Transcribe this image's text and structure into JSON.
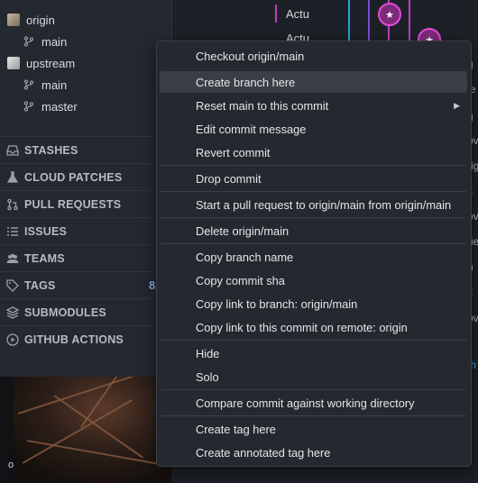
{
  "sidebar": {
    "remotes": [
      {
        "name": "origin",
        "branches": [
          "main"
        ]
      },
      {
        "name": "upstream",
        "branches": [
          "main",
          "master"
        ]
      }
    ],
    "sections": [
      {
        "label": "STASHES",
        "icon": "inbox-icon",
        "count": ""
      },
      {
        "label": "CLOUD PATCHES",
        "icon": "flask-icon",
        "count": ""
      },
      {
        "label": "PULL REQUESTS",
        "icon": "pull-request-icon",
        "count": ""
      },
      {
        "label": "ISSUES",
        "icon": "list-icon",
        "count": ""
      },
      {
        "label": "TEAMS",
        "icon": "people-icon",
        "count": ""
      },
      {
        "label": "TAGS",
        "icon": "tag-icon",
        "count": "8/"
      },
      {
        "label": "SUBMODULES",
        "icon": "stack-icon",
        "count": ""
      },
      {
        "label": "GITHUB ACTIONS",
        "icon": "play-icon",
        "count": ""
      }
    ],
    "bottom_letter": "o"
  },
  "graph": {
    "row_labels": [
      "Actu",
      "Actu"
    ],
    "edge_chars": [
      "g",
      "ie",
      "g",
      "ov",
      "rig",
      "k",
      "ov",
      "ue",
      "h",
      "k",
      "ov",
      "th"
    ]
  },
  "context_menu": {
    "highlighted": "Create branch here",
    "groups": [
      [
        "Checkout origin/main",
        "Create branch here",
        "Reset main to this commit",
        "Edit commit message",
        "Revert commit"
      ],
      [
        "Drop commit"
      ],
      [
        "Start a pull request to origin/main from origin/main"
      ],
      [
        "Delete origin/main"
      ],
      [
        "Copy branch name",
        "Copy commit sha",
        "Copy link to branch: origin/main",
        "Copy link to this commit on remote: origin"
      ],
      [
        "Hide",
        "Solo"
      ],
      [
        "Compare commit against working directory"
      ],
      [
        "Create tag here",
        "Create annotated tag here"
      ]
    ],
    "submenu_item": "Reset main to this commit"
  },
  "colors": {
    "accent_magenta": "#e24ad8",
    "lane_cyan": "#1fa3d6",
    "lane_purple": "#7b4bd8",
    "count_blue": "#8fa7e6",
    "highlight": "#3a3e45"
  }
}
